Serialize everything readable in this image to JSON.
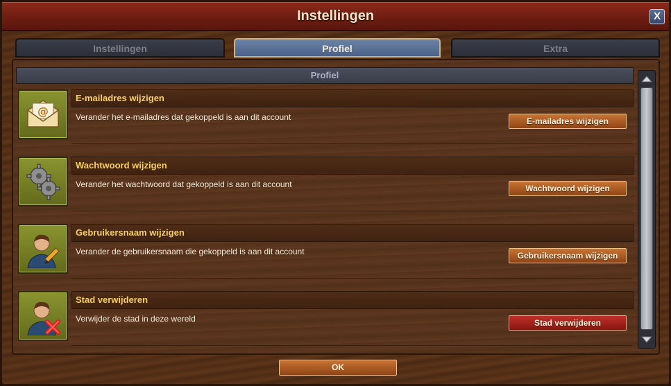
{
  "window": {
    "title": "Instellingen",
    "close_label": "X"
  },
  "tabs": [
    {
      "label": "Instellingen",
      "active": false
    },
    {
      "label": "Profiel",
      "active": true
    },
    {
      "label": "Extra",
      "active": false
    }
  ],
  "section": {
    "header": "Profiel"
  },
  "rows": [
    {
      "icon": "envelope-icon",
      "title": "E-mailadres wijzigen",
      "description": "Verander het e-mailadres dat gekoppeld is aan dit account",
      "button": "E-mailadres wijzigen",
      "button_style": "normal"
    },
    {
      "icon": "gears-icon",
      "title": "Wachtwoord wijzigen",
      "description": "Verander het wachtwoord dat gekoppeld is aan dit account",
      "button": "Wachtwoord wijzigen",
      "button_style": "normal"
    },
    {
      "icon": "user-edit-icon",
      "title": "Gebruikersnaam wijzigen",
      "description": "Verander de gebruikersnaam die gekoppeld is aan dit account",
      "button": "Gebruikersnaam wijzigen",
      "button_style": "normal"
    },
    {
      "icon": "user-delete-icon",
      "title": "Stad verwijderen",
      "description": "Verwijder de stad in deze wereld",
      "button": "Stad verwijderen",
      "button_style": "danger"
    }
  ],
  "footer": {
    "ok_label": "OK"
  },
  "colors": {
    "accent_title": "#f7cf62",
    "danger_button": "#c0302a",
    "primary_button": "#c87434",
    "active_tab": "#4b6187"
  }
}
